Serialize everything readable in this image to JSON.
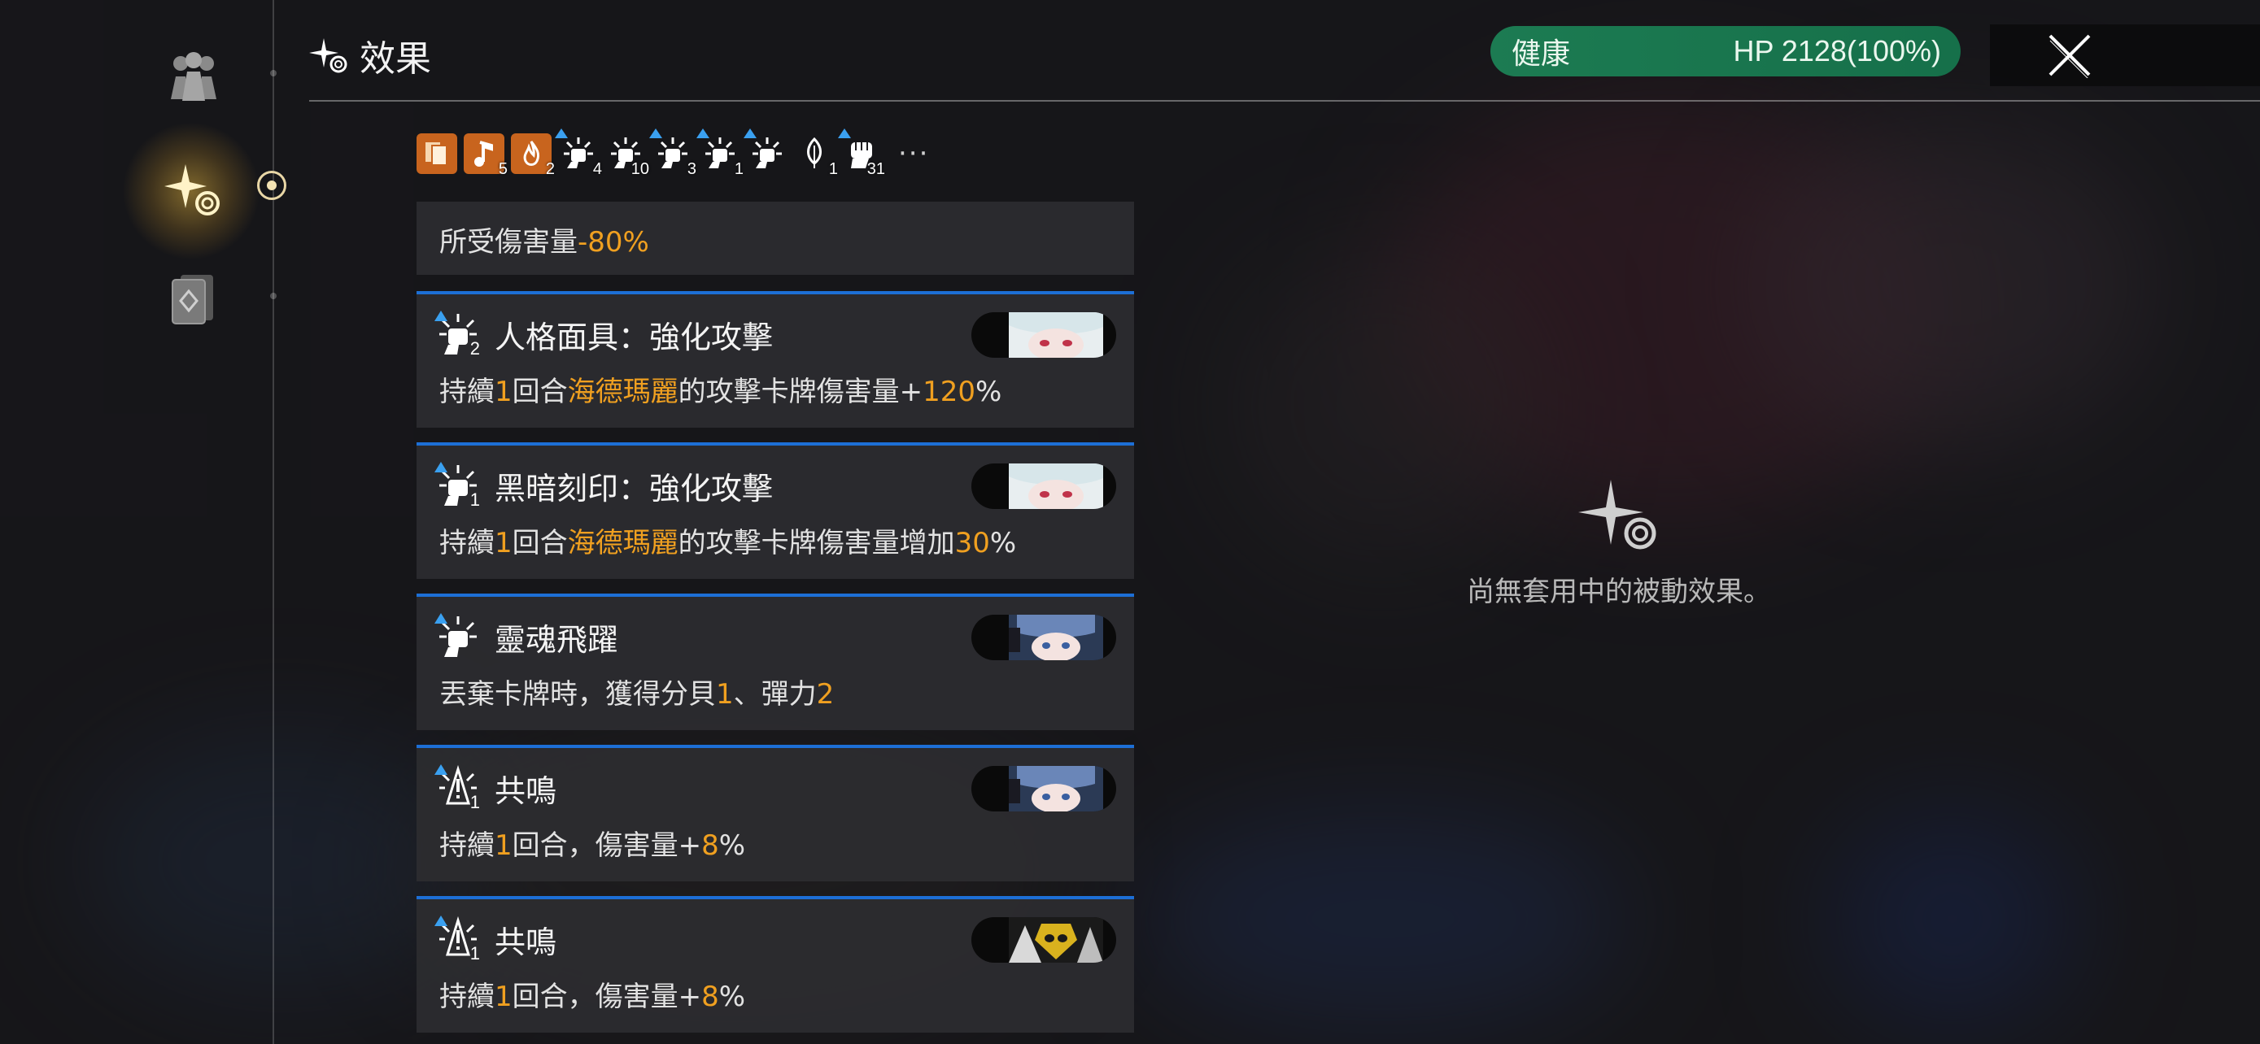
{
  "header": {
    "title": "效果",
    "hp_status": "健康",
    "hp_value": "HP 2128(100%)"
  },
  "icon_strip": [
    {
      "icon": "cards-icon",
      "count": ""
    },
    {
      "icon": "music-note-icon",
      "count": "5"
    },
    {
      "icon": "flame-icon",
      "count": "2"
    },
    {
      "icon": "fist-burst-icon",
      "count": "4"
    },
    {
      "icon": "fist-burst-icon",
      "count": "10"
    },
    {
      "icon": "fist-burst-icon",
      "count": "3"
    },
    {
      "icon": "fist-burst-icon",
      "count": "1"
    },
    {
      "icon": "fist-burst-icon",
      "count": ""
    },
    {
      "icon": "leaf-icon",
      "count": "1"
    },
    {
      "icon": "fist-icon",
      "count": "31"
    }
  ],
  "more_label": "···",
  "effects": {
    "partial": {
      "pre": "所受傷害量",
      "val": "-80",
      "post": "%"
    },
    "items": [
      {
        "title": "人格面具：強化攻擊",
        "count": "2",
        "d1": "持續",
        "n1": "1",
        "d2": "回合",
        "name": "海德瑪麗",
        "d3": "的攻擊卡牌傷害量+",
        "n2": "120",
        "d4": "%"
      },
      {
        "title": "黑暗刻印：強化攻擊",
        "count": "1",
        "d1": "持續",
        "n1": "1",
        "d2": "回合",
        "name": "海德瑪麗",
        "d3": "的攻擊卡牌傷害量增加",
        "n2": "30",
        "d4": "%"
      },
      {
        "title": "靈魂飛躍",
        "count": "",
        "d1": "丟棄卡牌時，獲得分貝",
        "n1": "1",
        "d2": "、彈力",
        "n2": "2"
      },
      {
        "title": "共鳴",
        "count": "1",
        "d1": "持續",
        "n1": "1",
        "d2": "回合，傷害量+",
        "n2": "8",
        "d3": "%"
      },
      {
        "title": "共鳴",
        "count": "1",
        "d1": "持續",
        "n1": "1",
        "d2": "回合，傷害量+",
        "n2": "8",
        "d3": "%"
      }
    ]
  },
  "empty_state": {
    "message": "尚無套用中的被動效果。"
  },
  "colors": {
    "accent_blue": "#1d6fd6",
    "highlight_orange": "#f0a020",
    "hp_green": "#1c7b52"
  }
}
